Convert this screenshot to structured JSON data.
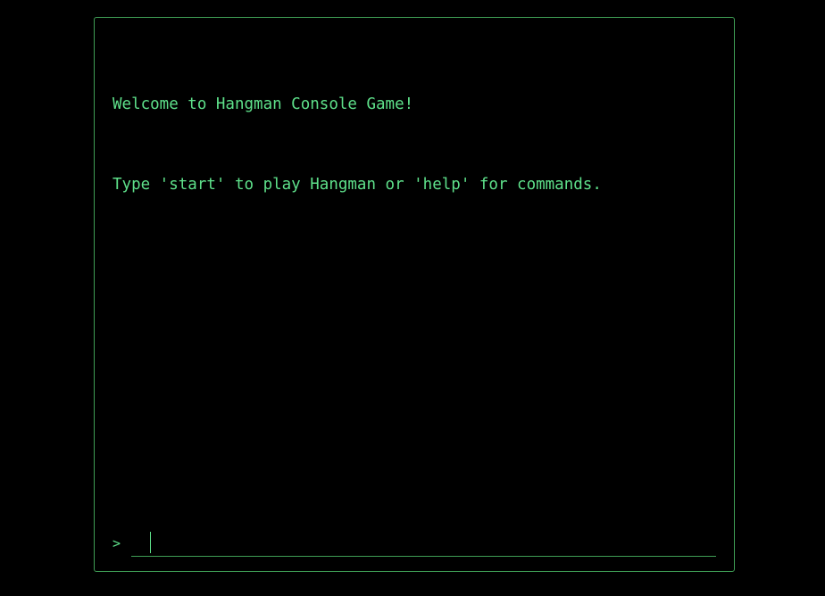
{
  "console": {
    "output_lines": [
      "Welcome to Hangman Console Game!",
      "Type 'start' to play Hangman or 'help' for commands."
    ],
    "prompt_symbol": ">",
    "input_value": "",
    "colors": {
      "background": "#000000",
      "text": "#5ee08a",
      "border": "#3f9e55"
    }
  }
}
